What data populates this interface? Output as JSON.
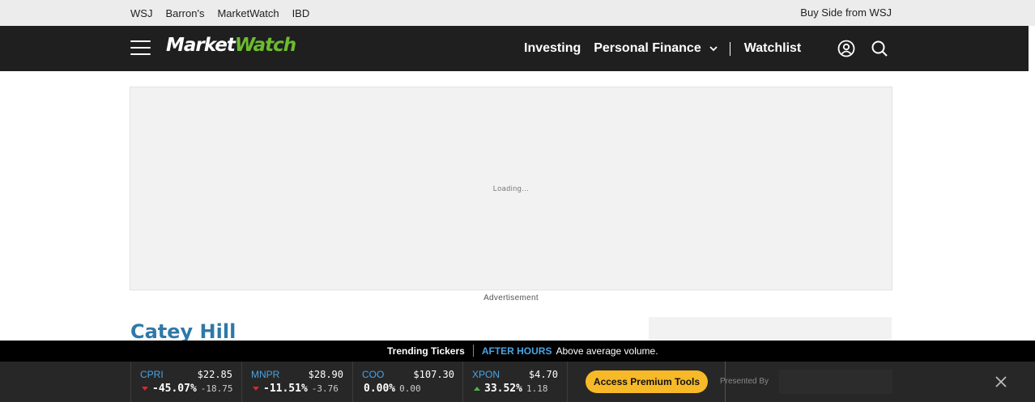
{
  "top_links": [
    "WSJ",
    "Barron's",
    "MarketWatch",
    "IBD"
  ],
  "top_right": "Buy Side from WSJ",
  "logo": {
    "part1": "Market",
    "part2": "Watch"
  },
  "nav": {
    "investing": "Investing",
    "personal_finance": "Personal Finance",
    "watchlist": "Watchlist"
  },
  "ad": {
    "loading": "Loading...",
    "label": "Advertisement"
  },
  "author": "Catey Hill",
  "trending": {
    "title": "Trending Tickers",
    "after_hours": "AFTER HOURS",
    "note": "Above average volume."
  },
  "tickers": [
    {
      "symbol": "CPRI",
      "price": "$22.85",
      "pct": "-45.07%",
      "pts": "-18.75",
      "dir": "down"
    },
    {
      "symbol": "MNPR",
      "price": "$28.90",
      "pct": "-11.51%",
      "pts": "-3.76",
      "dir": "down"
    },
    {
      "symbol": "COO",
      "price": "$107.30",
      "pct": "0.00%",
      "pts": "0.00",
      "dir": "none"
    },
    {
      "symbol": "XPON",
      "price": "$4.70",
      "pct": "33.52%",
      "pts": "1.18",
      "dir": "up"
    }
  ],
  "premium_button": "Access Premium Tools",
  "presented_by": "Presented By",
  "colors": {
    "accent_blue": "#4aa3e3",
    "logo_green": "#6cbc2e",
    "premium_yellow": "#f7b928",
    "down_red": "#e0242c",
    "up_green": "#4bb34b"
  }
}
